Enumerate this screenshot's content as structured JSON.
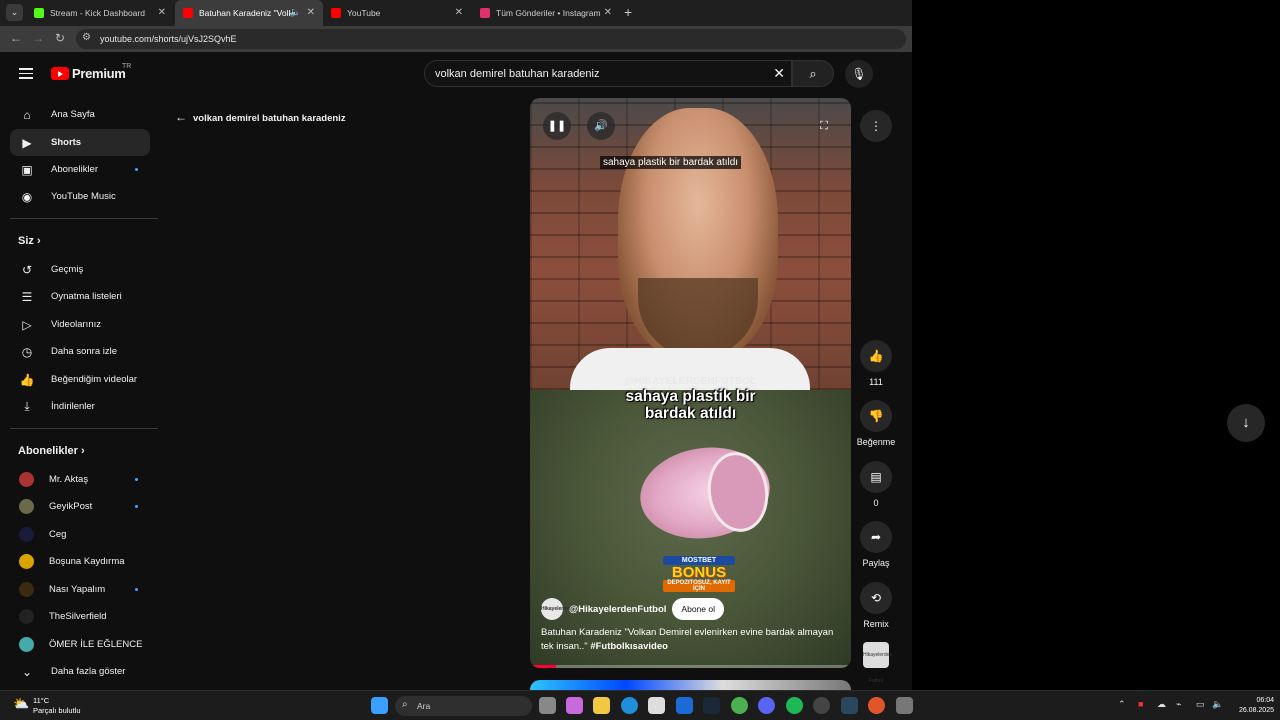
{
  "browser": {
    "tabs": [
      {
        "title": "Stream - Kick Dashboard",
        "favicon_color": "#53fc18",
        "active": false
      },
      {
        "title": "Batuhan Karadeniz \"Volkan",
        "favicon_color": "#ff0000",
        "active": true
      },
      {
        "title": "YouTube",
        "favicon_color": "#ff0000",
        "active": false
      },
      {
        "title": "Tüm Gönderiler • Instagram",
        "favicon_color": "#e1306c",
        "active": false
      }
    ],
    "url": "youtube.com/shorts/ujVsJ2SQvhE"
  },
  "youtube": {
    "logo_text": "Premium",
    "country_code": "TR",
    "search_query": "volkan demirel batuhan karadeniz",
    "back_query": "volkan demirel batuhan karadeniz",
    "sidebar": {
      "main": [
        {
          "label": "Ana Sayfa",
          "icon": "home-icon"
        },
        {
          "label": "Shorts",
          "icon": "shorts-icon",
          "active": true
        },
        {
          "label": "Abonelikler",
          "icon": "subscriptions-icon",
          "dot": true
        },
        {
          "label": "YouTube Music",
          "icon": "music-icon"
        }
      ],
      "you_heading": "Siz",
      "you": [
        {
          "label": "Geçmiş",
          "icon": "history-icon"
        },
        {
          "label": "Oynatma listeleri",
          "icon": "playlists-icon"
        },
        {
          "label": "Videolarınız",
          "icon": "your-videos-icon"
        },
        {
          "label": "Daha sonra izle",
          "icon": "watch-later-icon"
        },
        {
          "label": "Beğendiğim videolar",
          "icon": "liked-icon"
        },
        {
          "label": "İndirilenler",
          "icon": "downloads-icon"
        }
      ],
      "subs_heading": "Abonelikler",
      "subscriptions": [
        {
          "label": "Mr. Aktaş",
          "color": "#a33",
          "dot": true
        },
        {
          "label": "GeyikPost",
          "color": "#6a6a4a",
          "dot": true
        },
        {
          "label": "Ceg",
          "color": "#1a1a3a",
          "dot": false
        },
        {
          "label": "Boşuna Kaydırma",
          "color": "#d9a300",
          "dot": false
        },
        {
          "label": "Nası Yapalım",
          "color": "#3a2a10",
          "dot": true
        },
        {
          "label": "TheSilverfield",
          "color": "#222",
          "dot": false
        },
        {
          "label": "ÖMER İLE EĞLENCE",
          "color": "#4aa",
          "dot": false
        }
      ],
      "show_more": "Daha fazla göster"
    },
    "short": {
      "caption_small": "sahaya plastik bir bardak atıldı",
      "watermark": "@HIKAYELERDENFUTBOL",
      "caption_big_line1": "sahaya plastik bir",
      "caption_big_line2": "bardak atıldı",
      "promo_brand": "MOSTBET",
      "promo_bonus": "BONUS",
      "promo_sub": "DEPOZITOSUZ, KAYIT İÇİN",
      "channel_avatar_text": "Hikayelerden Futbol",
      "channel": "@HikayelerdenFutbol",
      "subscribe": "Abone ol",
      "description": "Batuhan Karadeniz \"Volkan Demirel evlenirken evine bardak almayan tek insan..\" ",
      "hashtag": "#Futbolkısavideo",
      "progress": 0.08
    },
    "actions": {
      "likes": "111",
      "dislike_label": "Beğenme",
      "comments": "0",
      "share_label": "Paylaş",
      "remix_label": "Remix"
    }
  },
  "taskbar": {
    "temperature": "11°C",
    "weather": "Parçalı bulutlu",
    "search_placeholder": "Ara",
    "time": "06:04",
    "date": "26.08.2025"
  }
}
